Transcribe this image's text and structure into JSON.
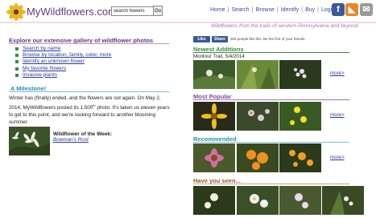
{
  "header": {
    "logo_text": "MyWildflowers.com",
    "search": {
      "value": "search flowers",
      "button_label": "Go"
    },
    "nav": [
      "Home",
      "Search",
      "Browse",
      "Identify",
      "Buy",
      "Login"
    ],
    "tagline": "Wildflowers from the trails of western Pennsylvania and beyond",
    "social_icons": [
      "facebook-icon",
      "rss-icon",
      "email-icon"
    ],
    "social_glyphs": {
      "facebook": "f",
      "rss": "◣",
      "email": "✉"
    }
  },
  "explore": {
    "title": "Explore our extensive gallery of wildflower photos",
    "links": [
      "Search by name",
      "Browse by location, family, color, more",
      "Identify an unknown flower",
      "My favorite flowers",
      "Invasive plants"
    ]
  },
  "milestone": {
    "title": "A Milestone!",
    "text_before": "Winter has (finally) ended, and the flowers are out again. On May 2, 2014, MyWildflowers posted its 1,500",
    "superscript": "th",
    "text_after": " photo. It's taken us eleven years to get to this point, and we're looking forward to another blooming summer."
  },
  "wildflower_of_week": {
    "label": "Wildflower of the Week:",
    "link": "Bowman's Root"
  },
  "facebook": {
    "like_label": "Like",
    "share_label": "Share",
    "count_text": "353 people like this. Be the first of your friends."
  },
  "sections": [
    {
      "title": "Newest Additions",
      "subtitle": "Montour Trail, 5/4/2014",
      "more": "more>"
    },
    {
      "title": "Most Popular",
      "more": "more>"
    },
    {
      "title": "Recommended",
      "more": "more>"
    },
    {
      "title": "Have you seen...",
      "more": ""
    }
  ],
  "colors": {
    "accent_purple": "#5a3a8a",
    "link_blue": "#2a3a9a",
    "green": "#3c8a3c",
    "teal": "#2a8ab0"
  }
}
